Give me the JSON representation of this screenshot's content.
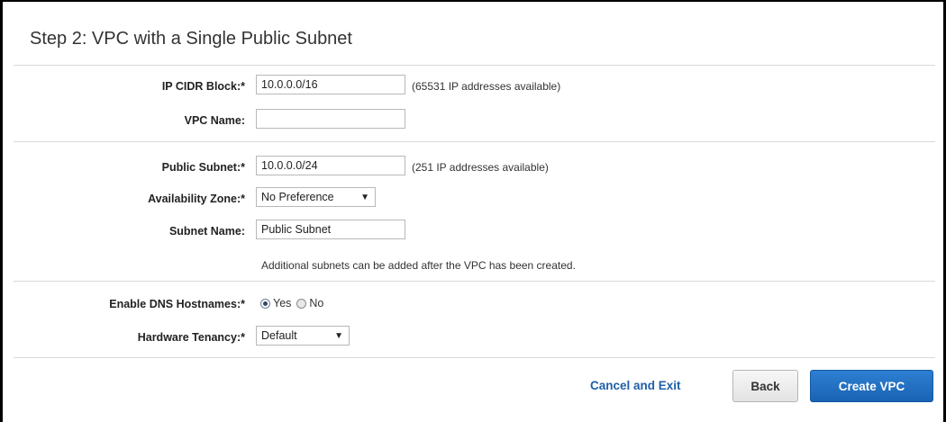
{
  "page": {
    "title": "Step 2: VPC with a Single Public Subnet"
  },
  "vpc": {
    "cidr_label": "IP CIDR Block:",
    "cidr_value": "10.0.0.0/16",
    "cidr_hint": "(65531 IP addresses available)",
    "name_label": "VPC Name:",
    "name_value": ""
  },
  "subnet": {
    "public_label": "Public Subnet:",
    "public_value": "10.0.0.0/24",
    "public_hint": "(251 IP addresses available)",
    "az_label": "Availability Zone:",
    "az_value": "No Preference",
    "name_label": "Subnet Name:",
    "name_value": "Public Subnet",
    "note": "Additional subnets can be added after the VPC has been created."
  },
  "options": {
    "dns_label": "Enable DNS Hostnames:",
    "dns_yes": "Yes",
    "dns_no": "No",
    "dns_selected": "Yes",
    "tenancy_label": "Hardware Tenancy:",
    "tenancy_value": "Default"
  },
  "required_marker": "*",
  "actions": {
    "cancel": "Cancel and Exit",
    "back": "Back",
    "create": "Create VPC"
  },
  "colors": {
    "link": "#1f5fa8",
    "primary_button": "#1a63b3"
  }
}
